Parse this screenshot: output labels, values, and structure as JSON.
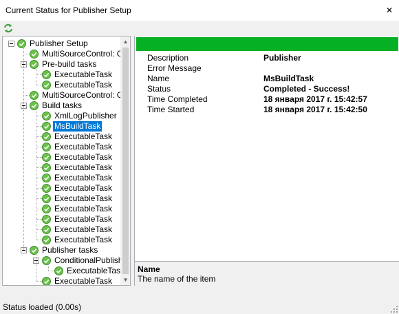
{
  "window": {
    "title": "Current Status for Publisher Setup",
    "close_glyph": "✕"
  },
  "toolbar": {
    "refresh_icon": "refresh-icon"
  },
  "tree": {
    "nodes": [
      {
        "label": "Publisher Setup",
        "level": 0,
        "expanded": true
      },
      {
        "label": "MultiSourceControl: CheckoutSources",
        "level": 1
      },
      {
        "label": "Pre-build tasks",
        "level": 1,
        "expanded": true
      },
      {
        "label": "ExecutableTask",
        "level": 2
      },
      {
        "label": "ExecutableTask",
        "level": 2
      },
      {
        "label": "MultiSourceControl: GetSources",
        "level": 1
      },
      {
        "label": "Build tasks",
        "level": 1,
        "expanded": true
      },
      {
        "label": "XmlLogPublisher",
        "level": 2
      },
      {
        "label": "MsBuildTask",
        "level": 2,
        "selected": true
      },
      {
        "label": "ExecutableTask",
        "level": 2
      },
      {
        "label": "ExecutableTask",
        "level": 2
      },
      {
        "label": "ExecutableTask",
        "level": 2
      },
      {
        "label": "ExecutableTask",
        "level": 2
      },
      {
        "label": "ExecutableTask",
        "level": 2
      },
      {
        "label": "ExecutableTask",
        "level": 2
      },
      {
        "label": "ExecutableTask",
        "level": 2
      },
      {
        "label": "ExecutableTask",
        "level": 2
      },
      {
        "label": "ExecutableTask",
        "level": 2
      },
      {
        "label": "ExecutableTask",
        "level": 2
      },
      {
        "label": "ExecutableTask",
        "level": 2
      },
      {
        "label": "Publisher tasks",
        "level": 1,
        "expanded": true
      },
      {
        "label": "ConditionalPublisher",
        "level": 2,
        "expanded": true
      },
      {
        "label": "ExecutableTask",
        "level": 3
      },
      {
        "label": "ExecutableTask",
        "level": 2
      }
    ]
  },
  "properties": {
    "status_color": "#06b025",
    "rows": [
      {
        "name": "Description",
        "value": "Publisher"
      },
      {
        "name": "Error Message",
        "value": ""
      },
      {
        "name": "Name",
        "value": "MsBuildTask"
      },
      {
        "name": "Status",
        "value": "Completed - Success!"
      },
      {
        "name": "Time Completed",
        "value": "18 января 2017 г. 15:42:57"
      },
      {
        "name": "Time Started",
        "value": "18 января 2017 г. 15:42:50"
      }
    ]
  },
  "description": {
    "title": "Name",
    "text": "The name of the item"
  },
  "statusbar": {
    "text": "Status loaded (0.00s)"
  }
}
